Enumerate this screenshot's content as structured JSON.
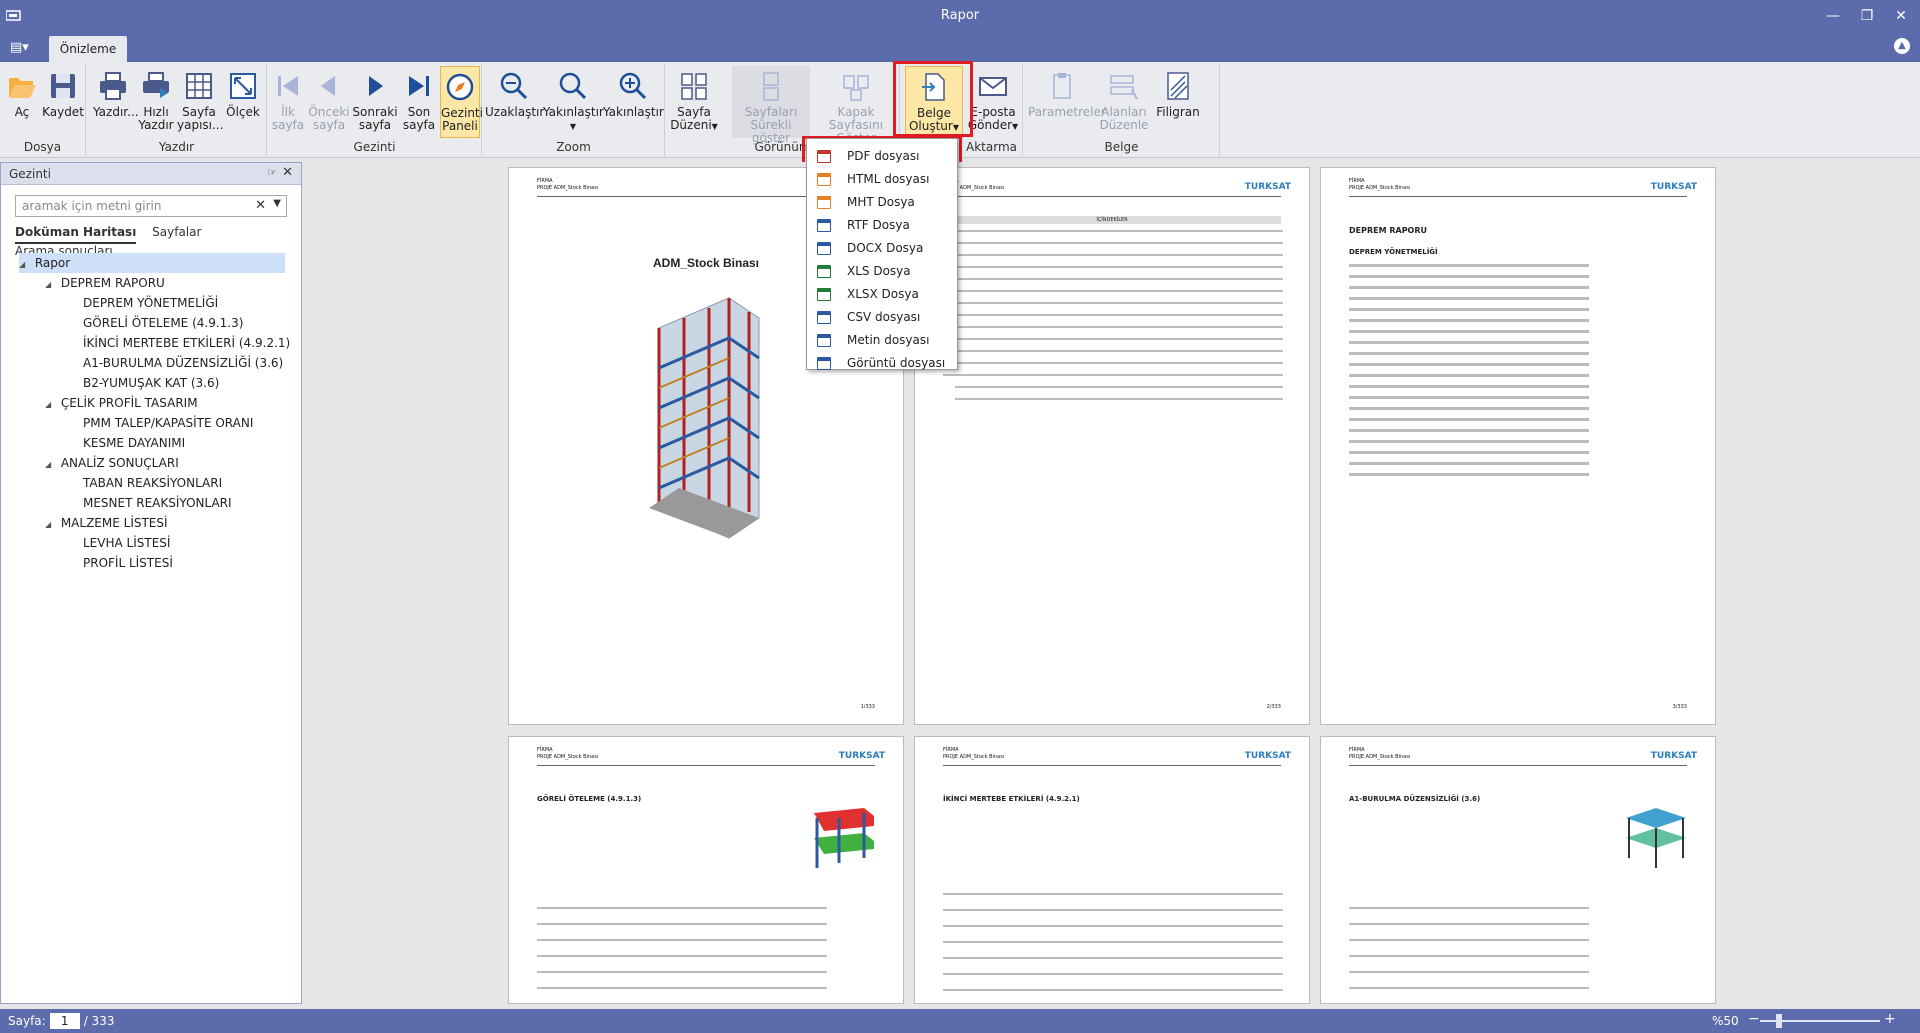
{
  "window": {
    "title": "Rapor"
  },
  "tabs": {
    "active": "Önizleme"
  },
  "ribbon": {
    "groups": [
      {
        "caption": "Dosya"
      },
      {
        "caption": "Yazdır"
      },
      {
        "caption": "Gezinti"
      },
      {
        "caption": "Zoom"
      },
      {
        "caption": "Görünüm"
      },
      {
        "caption": "Aktarma"
      },
      {
        "caption": "Belge"
      }
    ],
    "buttons": {
      "open": "Aç",
      "save": "Kaydet",
      "print": "Yazdır...",
      "quick_print_1": "Hızlı",
      "quick_print_2": "Yazdır",
      "page_setup_1": "Sayfa",
      "page_setup_2": "yapısı...",
      "scale": "Ölçek",
      "first_1": "İlk",
      "first_2": "sayfa",
      "prev_1": "Önceki",
      "prev_2": "sayfa",
      "next_1": "Sonraki",
      "next_2": "sayfa",
      "last_1": "Son",
      "last_2": "sayfa",
      "nav_panel_1": "Gezinti",
      "nav_panel_2": "Paneli",
      "zoom_out": "Uzaklaştır",
      "zoom_in_drop": "Yakınlaştır",
      "zoom_in": "Yakınlaştır",
      "page_layout_1": "Sayfa",
      "page_layout_2": "Düzeni",
      "continuous_1": "Sayfaları",
      "continuous_2": "Sürekli göster",
      "cover_1": "Kapak Sayfasını",
      "cover_2": "Göster",
      "export_1": "Belge",
      "export_2": "Oluştur",
      "email_1": "E-posta",
      "email_2": "Gönder",
      "params": "Parametreler",
      "fields_1": "Alanları",
      "fields_2": "Düzenle",
      "watermark": "Filigran"
    }
  },
  "export_menu": {
    "items": [
      {
        "label": "PDF dosyası",
        "color": "#c0392b"
      },
      {
        "label": "HTML dosyası",
        "color": "#e67e22"
      },
      {
        "label": "MHT Dosya",
        "color": "#e67e22"
      },
      {
        "label": "RTF Dosya",
        "color": "#2c5aa0"
      },
      {
        "label": "DOCX Dosya",
        "color": "#2c5aa0"
      },
      {
        "label": "XLS Dosya",
        "color": "#1e7e34"
      },
      {
        "label": "XLSX Dosya",
        "color": "#1e7e34"
      },
      {
        "label": "CSV dosyası",
        "color": "#2c5aa0"
      },
      {
        "label": "Metin dosyası",
        "color": "#2c5aa0"
      },
      {
        "label": "Görüntü dosyası",
        "color": "#2c5aa0"
      }
    ]
  },
  "nav_panel": {
    "title": "Gezinti",
    "search_placeholder": "aramak için metni girin",
    "tabs": [
      "Doküman Haritası",
      "Sayfalar",
      "Arama sonuçları"
    ],
    "tree": [
      {
        "label": "Rapor",
        "level": 0
      },
      {
        "label": "DEPREM RAPORU",
        "level": 1
      },
      {
        "label": "DEPREM YÖNETMELİĞİ",
        "level": 2
      },
      {
        "label": "GÖRELİ ÖTELEME (4.9.1.3)",
        "level": 2
      },
      {
        "label": "İKİNCİ MERTEBE ETKİLERİ (4.9.2.1)",
        "level": 2
      },
      {
        "label": "A1-BURULMA DÜZENSİZLİĞİ (3.6)",
        "level": 2
      },
      {
        "label": "B2-YUMUŞAK KAT (3.6)",
        "level": 2
      },
      {
        "label": "ÇELİK PROFİL TASARIM",
        "level": 1
      },
      {
        "label": "PMM TALEP/KAPASİTE ORANI",
        "level": 2
      },
      {
        "label": "KESME DAYANIMI",
        "level": 2
      },
      {
        "label": "ANALİZ SONUÇLARI",
        "level": 1
      },
      {
        "label": "TABAN REAKSİYONLARI",
        "level": 2
      },
      {
        "label": "MESNET REAKSİYONLARI",
        "level": 2
      },
      {
        "label": "MALZEME LİSTESİ",
        "level": 1
      },
      {
        "label": "LEVHA LİSTESİ",
        "level": 2
      },
      {
        "label": "PROFİL LİSTESİ",
        "level": 2
      }
    ]
  },
  "pages": [
    {
      "heading": "ADM_Stock Binası",
      "num": "1/333"
    },
    {
      "heading": "İÇİNDEKİLER",
      "num": "2/333"
    },
    {
      "heading": "DEPREM RAPORU",
      "sub": "DEPREM YÖNETMELİĞİ",
      "num": "3/333"
    },
    {
      "heading": "GÖRELİ ÖTELEME (4.9.1.3)"
    },
    {
      "heading": "İKİNCİ MERTEBE ETKİLERİ (4.9.2.1)"
    },
    {
      "heading": "A1-BURULMA DÜZENSİZLİĞİ (3.6)"
    }
  ],
  "page_header": {
    "firma": "FİRMA",
    "proje": "PROJE",
    "proje_val": "ADM_Stock Binası",
    "logo": "TURKSAT"
  },
  "status": {
    "page_label": "Sayfa:",
    "page_value": "1",
    "page_total": "/ 333",
    "zoom": "%50"
  }
}
